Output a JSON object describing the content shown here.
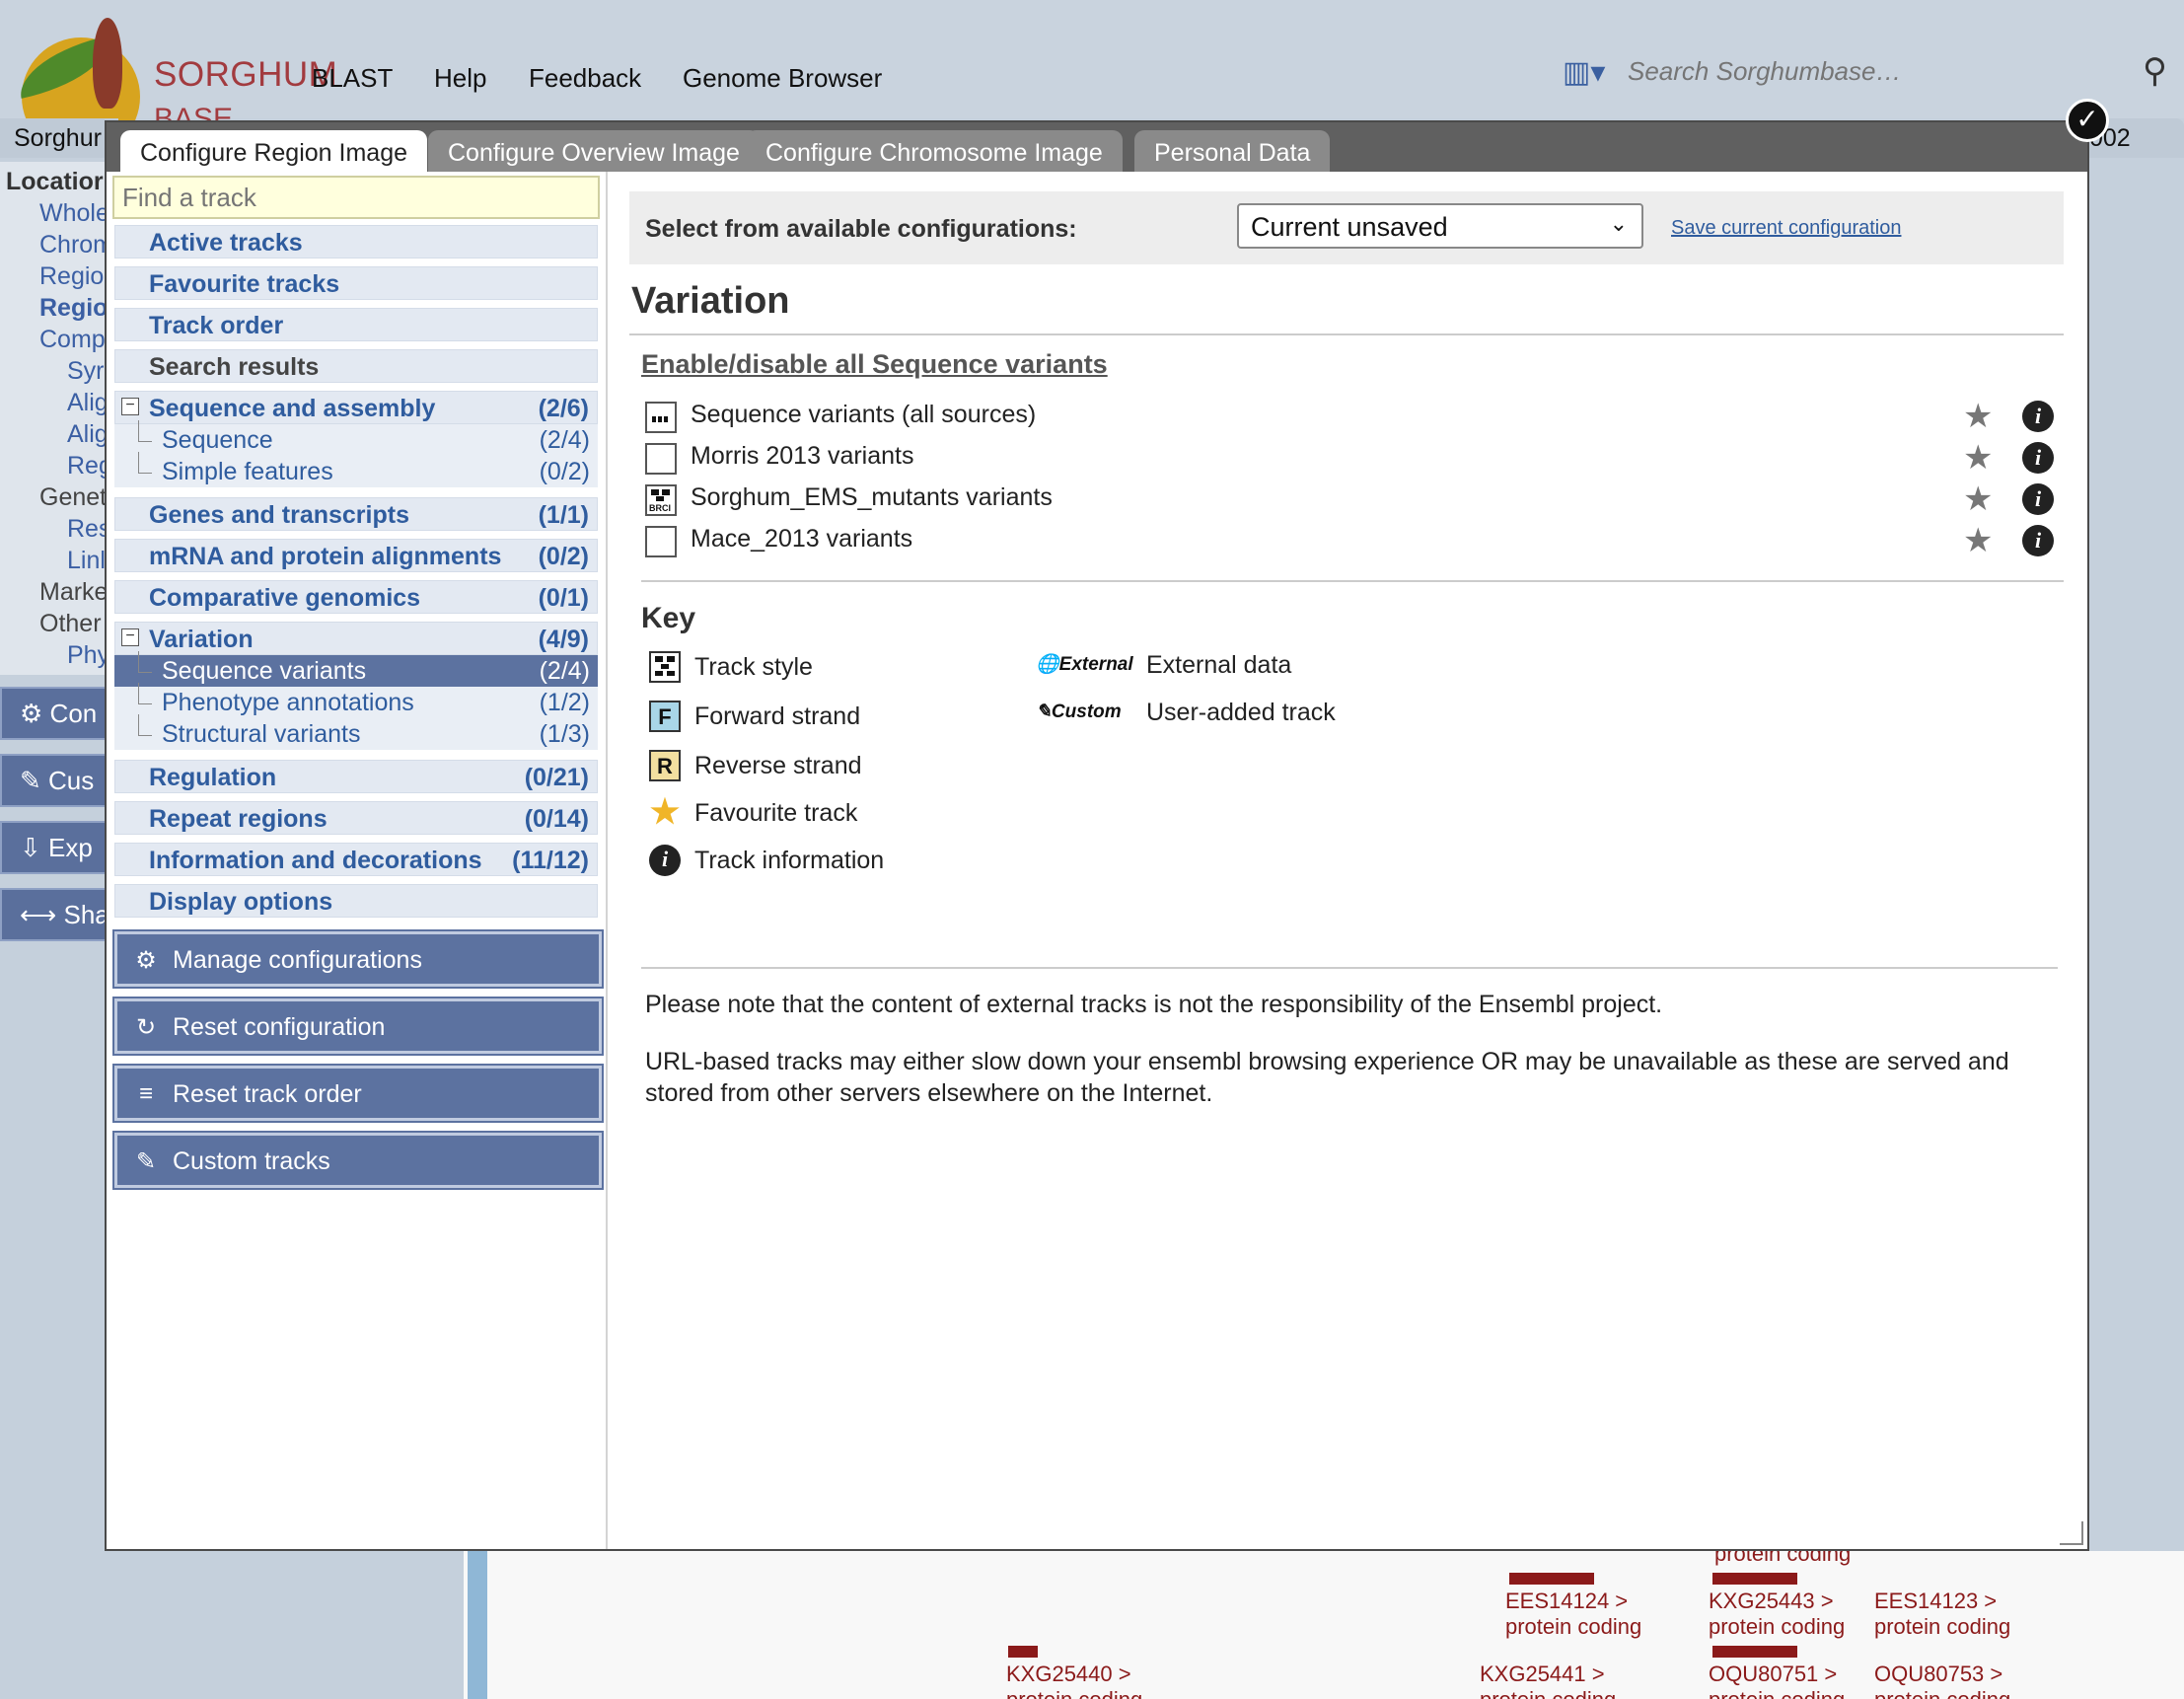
{
  "site": {
    "logo_line1": "SORGHUM",
    "logo_line2": "BASE",
    "nav": [
      "BLAST",
      "Help",
      "Feedback",
      "Genome Browser"
    ],
    "search_placeholder": "Search Sorghumbase…",
    "species_tab": "Sorghur",
    "right_tab_stub": "002"
  },
  "background_tree": {
    "items": [
      "Locatior",
      "Whole",
      "Chrom",
      "Regio",
      "Regio",
      "Comp",
      "Syr",
      "Alig",
      "Alig",
      "Reg",
      "Genet",
      "Res",
      "Linl",
      "Marke",
      "Other",
      "Phy"
    ]
  },
  "background_buttons": [
    "Con",
    "Cus",
    "Exp",
    "Sha"
  ],
  "background_features": [
    {
      "name": "EES14124 >",
      "type": "protein coding"
    },
    {
      "name": "KXG25443 >",
      "type": "protein coding"
    },
    {
      "name": "EES14123 >",
      "type": "protein coding"
    },
    {
      "name": "KXG25440 >",
      "type": "protein coding"
    },
    {
      "name": "KXG25441 >",
      "type": "protein coding"
    },
    {
      "name": "OQU80751 >",
      "type": "protein coding"
    },
    {
      "name": "OQU80753 >",
      "type": "protein coding"
    }
  ],
  "background_feature_top_label": "protein coding",
  "modal": {
    "tabs": [
      "Configure Region Image",
      "Configure Overview Image",
      "Configure Chromosome Image",
      "Personal Data"
    ],
    "active_tab": 0,
    "track_search_placeholder": "Find a track",
    "sidebar": {
      "top_items": [
        "Active tracks",
        "Favourite tracks",
        "Track order",
        "Search results"
      ],
      "categories": [
        {
          "label": "Sequence and assembly",
          "count": "(2/6)",
          "expanded": true,
          "children": [
            {
              "label": "Sequence",
              "count": "(2/4)"
            },
            {
              "label": "Simple features",
              "count": "(0/2)"
            }
          ]
        },
        {
          "label": "Genes and transcripts",
          "count": "(1/1)"
        },
        {
          "label": "mRNA and protein alignments",
          "count": "(0/2)"
        },
        {
          "label": "Comparative genomics",
          "count": "(0/1)"
        },
        {
          "label": "Variation",
          "count": "(4/9)",
          "expanded": true,
          "children": [
            {
              "label": "Sequence variants",
              "count": "(2/4)",
              "selected": true
            },
            {
              "label": "Phenotype annotations",
              "count": "(1/2)"
            },
            {
              "label": "Structural variants",
              "count": "(1/3)"
            }
          ]
        },
        {
          "label": "Regulation",
          "count": "(0/21)"
        },
        {
          "label": "Repeat regions",
          "count": "(0/14)"
        },
        {
          "label": "Information and decorations",
          "count": "(11/12)"
        },
        {
          "label": "Display options",
          "count": ""
        }
      ],
      "buttons": [
        "Manage configurations",
        "Reset configuration",
        "Reset track order",
        "Custom tracks"
      ]
    },
    "config": {
      "label": "Select from available configurations:",
      "selected": "Current unsaved",
      "save_link": "Save current configuration"
    },
    "section_title": "Variation",
    "enable_all_link": "Enable/disable all Sequence variants",
    "tracks": [
      {
        "name": "Sequence variants (all sources)",
        "style_icon": "compact-style-icon"
      },
      {
        "name": "Morris 2013 variants",
        "style_icon": "off"
      },
      {
        "name": "Sorghum_EMS_mutants variants",
        "style_icon": "brci-style-icon"
      },
      {
        "name": "Mace_2013 variants",
        "style_icon": "off"
      }
    ],
    "key": {
      "title": "Key",
      "items": [
        {
          "icon": "track-style-icon",
          "label": "Track style"
        },
        {
          "icon": "F",
          "label": "Forward strand"
        },
        {
          "icon": "R",
          "label": "Reverse strand"
        },
        {
          "icon": "star-icon",
          "label": "Favourite track"
        },
        {
          "icon": "info-icon",
          "label": "Track information"
        }
      ],
      "items_right": [
        {
          "icon_text": "External",
          "label": "External data"
        },
        {
          "icon_text": "Custom",
          "label": "User-added track"
        }
      ]
    },
    "notes": [
      "Please note that the content of external tracks is not the responsibility of the Ensembl project.",
      "URL-based tracks may either slow down your ensembl browsing experience OR may be unavailable as these are served and stored from other servers elsewhere on the Internet."
    ]
  },
  "colors": {
    "accent_blue": "#2f5c9e",
    "selected_bg": "#5c72a0",
    "brand_red": "#a23b3f",
    "feature_red": "#8b1a1a"
  }
}
